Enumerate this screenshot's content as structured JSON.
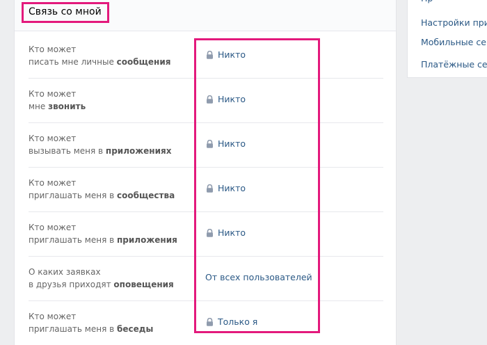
{
  "panel": {
    "title": "Связь со мной"
  },
  "settings": [
    {
      "line1": "Кто может",
      "line2_plain": "писать мне личные ",
      "line2_bold": "сообщения",
      "value": "Никто",
      "locked": true
    },
    {
      "line1": "Кто может",
      "line2_plain": "мне ",
      "line2_bold": "звонить",
      "value": "Никто",
      "locked": true
    },
    {
      "line1": "Кто может",
      "line2_plain": "вызывать меня в ",
      "line2_bold": "приложениях",
      "value": "Никто",
      "locked": true
    },
    {
      "line1": "Кто может",
      "line2_plain": "приглашать меня в ",
      "line2_bold": "сообщества",
      "value": "Никто",
      "locked": true
    },
    {
      "line1": "Кто может",
      "line2_plain": "приглашать меня в ",
      "line2_bold": "приложения",
      "value": "Никто",
      "locked": true
    },
    {
      "line1": "О каких заявках",
      "line2_plain": "в друзья приходят ",
      "line2_bold": "оповещения",
      "value": "От всех пользователей",
      "locked": false
    },
    {
      "line1": "Кто может",
      "line2_plain": "приглашать меня в ",
      "line2_bold": "беседы",
      "value": "Только я",
      "locked": true
    }
  ],
  "side_menu": {
    "items": [
      {
        "label": "Настройки приложений"
      },
      {
        "label": "Мобильные сервисы"
      },
      {
        "label": "Платёжные сервисы"
      }
    ]
  },
  "colors": {
    "accent": "#e3197c",
    "link": "#2a5885",
    "lock": "#8f9bad",
    "background": "#edeef0"
  },
  "icons": {
    "lock": "lock-icon"
  }
}
